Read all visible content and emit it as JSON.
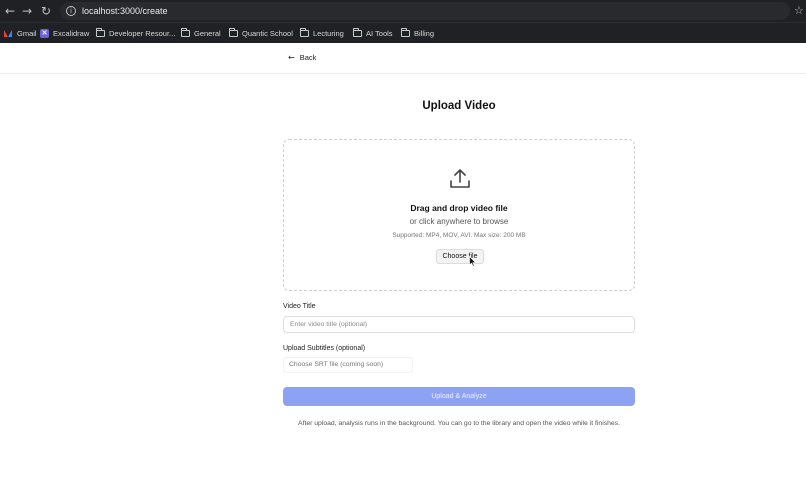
{
  "browser": {
    "url": "localhost:3000/create",
    "bookmarks": [
      {
        "label": "Gmail",
        "icon": "gmail-icon"
      },
      {
        "label": "Excalidraw",
        "icon": "excalidraw-icon"
      },
      {
        "label": "Developer Resour...",
        "icon": "folder-icon"
      },
      {
        "label": "General",
        "icon": "folder-icon"
      },
      {
        "label": "Quantic School",
        "icon": "folder-icon"
      },
      {
        "label": "Lecturing",
        "icon": "folder-icon"
      },
      {
        "label": "AI Tools",
        "icon": "folder-icon"
      },
      {
        "label": "Billing",
        "icon": "folder-icon"
      }
    ]
  },
  "header": {
    "back_label": "Back"
  },
  "main": {
    "title": "Upload Video",
    "dropzone": {
      "title": "Drag and drop video file",
      "subtitle": "or click anywhere to browse",
      "hint": "Supported: MP4, MOV, AVI. Max size: 200 MB",
      "choose_label": "Choose file"
    },
    "video_title": {
      "label": "Video Title",
      "placeholder": "Enter video title (optional)",
      "value": ""
    },
    "subtitles": {
      "label": "Upload Subtitles (optional)",
      "placeholder": "Choose SRT file (coming soon)"
    },
    "submit_label": "Upload & Analyze",
    "footnote": "After upload, analysis runs in the background. You can go to the library and open the video while it finishes."
  },
  "colors": {
    "accent": "#8da2f2",
    "chrome": "#202124"
  }
}
